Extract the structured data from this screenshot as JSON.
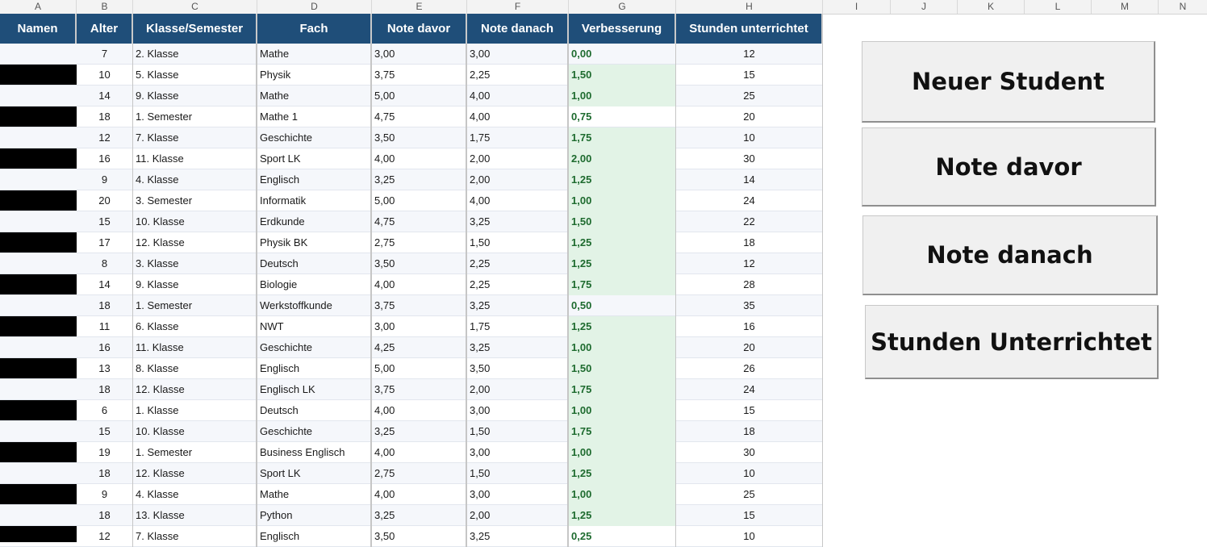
{
  "column_letters": [
    "A",
    "B",
    "C",
    "D",
    "E",
    "F",
    "G",
    "H",
    "I",
    "J",
    "K",
    "L",
    "M",
    "N"
  ],
  "headers": {
    "names": "Namen",
    "age": "Alter",
    "class": "Klasse/Semester",
    "subject": "Fach",
    "grade_before": "Note davor",
    "grade_after": "Note danach",
    "improvement": "Verbesserung",
    "hours": "Stunden unterrichtet"
  },
  "rows": [
    {
      "age": "7",
      "class": "2. Klasse",
      "subject": "Mathe",
      "before": "3,00",
      "after": "3,00",
      "improvement": "0,00",
      "hours": "12",
      "highlight": false
    },
    {
      "age": "10",
      "class": "5. Klasse",
      "subject": "Physik",
      "before": "3,75",
      "after": "2,25",
      "improvement": "1,50",
      "hours": "15",
      "highlight": true
    },
    {
      "age": "14",
      "class": "9. Klasse",
      "subject": "Mathe",
      "before": "5,00",
      "after": "4,00",
      "improvement": "1,00",
      "hours": "25",
      "highlight": true
    },
    {
      "age": "18",
      "class": "1. Semester",
      "subject": "Mathe 1",
      "before": "4,75",
      "after": "4,00",
      "improvement": "0,75",
      "hours": "20",
      "highlight": false
    },
    {
      "age": "12",
      "class": "7. Klasse",
      "subject": "Geschichte",
      "before": "3,50",
      "after": "1,75",
      "improvement": "1,75",
      "hours": "10",
      "highlight": true
    },
    {
      "age": "16",
      "class": "11. Klasse",
      "subject": "Sport LK",
      "before": "4,00",
      "after": "2,00",
      "improvement": "2,00",
      "hours": "30",
      "highlight": true
    },
    {
      "age": "9",
      "class": "4. Klasse",
      "subject": "Englisch",
      "before": "3,25",
      "after": "2,00",
      "improvement": "1,25",
      "hours": "14",
      "highlight": true
    },
    {
      "age": "20",
      "class": "3. Semester",
      "subject": "Informatik",
      "before": "5,00",
      "after": "4,00",
      "improvement": "1,00",
      "hours": "24",
      "highlight": true
    },
    {
      "age": "15",
      "class": "10. Klasse",
      "subject": "Erdkunde",
      "before": "4,75",
      "after": "3,25",
      "improvement": "1,50",
      "hours": "22",
      "highlight": true
    },
    {
      "age": "17",
      "class": "12. Klasse",
      "subject": "Physik BK",
      "before": "2,75",
      "after": "1,50",
      "improvement": "1,25",
      "hours": "18",
      "highlight": true
    },
    {
      "age": "8",
      "class": "3. Klasse",
      "subject": "Deutsch",
      "before": "3,50",
      "after": "2,25",
      "improvement": "1,25",
      "hours": "12",
      "highlight": true
    },
    {
      "age": "14",
      "class": "9. Klasse",
      "subject": "Biologie",
      "before": "4,00",
      "after": "2,25",
      "improvement": "1,75",
      "hours": "28",
      "highlight": true
    },
    {
      "age": "18",
      "class": "1. Semester",
      "subject": "Werkstoffkunde",
      "before": "3,75",
      "after": "3,25",
      "improvement": "0,50",
      "hours": "35",
      "highlight": false
    },
    {
      "age": "11",
      "class": "6. Klasse",
      "subject": "NWT",
      "before": "3,00",
      "after": "1,75",
      "improvement": "1,25",
      "hours": "16",
      "highlight": true
    },
    {
      "age": "16",
      "class": "11. Klasse",
      "subject": "Geschichte",
      "before": "4,25",
      "after": "3,25",
      "improvement": "1,00",
      "hours": "20",
      "highlight": true
    },
    {
      "age": "13",
      "class": "8. Klasse",
      "subject": "Englisch",
      "before": "5,00",
      "after": "3,50",
      "improvement": "1,50",
      "hours": "26",
      "highlight": true
    },
    {
      "age": "18",
      "class": "12. Klasse",
      "subject": "Englisch LK",
      "before": "3,75",
      "after": "2,00",
      "improvement": "1,75",
      "hours": "24",
      "highlight": true
    },
    {
      "age": "6",
      "class": "1. Klasse",
      "subject": "Deutsch",
      "before": "4,00",
      "after": "3,00",
      "improvement": "1,00",
      "hours": "15",
      "highlight": true
    },
    {
      "age": "15",
      "class": "10. Klasse",
      "subject": "Geschichte",
      "before": "3,25",
      "after": "1,50",
      "improvement": "1,75",
      "hours": "18",
      "highlight": true
    },
    {
      "age": "19",
      "class": "1.  Semester",
      "subject": "Business Englisch",
      "before": "4,00",
      "after": "3,00",
      "improvement": "1,00",
      "hours": "30",
      "highlight": true
    },
    {
      "age": "18",
      "class": "12. Klasse",
      "subject": "Sport LK",
      "before": "2,75",
      "after": "1,50",
      "improvement": "1,25",
      "hours": "10",
      "highlight": true
    },
    {
      "age": "9",
      "class": "4. Klasse",
      "subject": "Mathe",
      "before": "4,00",
      "after": "3,00",
      "improvement": "1,00",
      "hours": "25",
      "highlight": true
    },
    {
      "age": "18",
      "class": "13. Klasse",
      "subject": "Python",
      "before": "3,25",
      "after": "2,00",
      "improvement": "1,25",
      "hours": "15",
      "highlight": true
    },
    {
      "age": "12",
      "class": "7. Klasse",
      "subject": "Englisch",
      "before": "3,50",
      "after": "3,25",
      "improvement": "0,25",
      "hours": "10",
      "highlight": false
    }
  ],
  "buttons": {
    "new_student": "Neuer Student",
    "grade_before": "Note davor",
    "grade_after": "Note danach",
    "hours_taught": "Stunden Unterrichtet"
  },
  "colors": {
    "header_bg": "#1f4e79",
    "improvement_text": "#1e6b2f",
    "improvement_fill": "#e2f3e6",
    "names_redaction": "#000000"
  }
}
